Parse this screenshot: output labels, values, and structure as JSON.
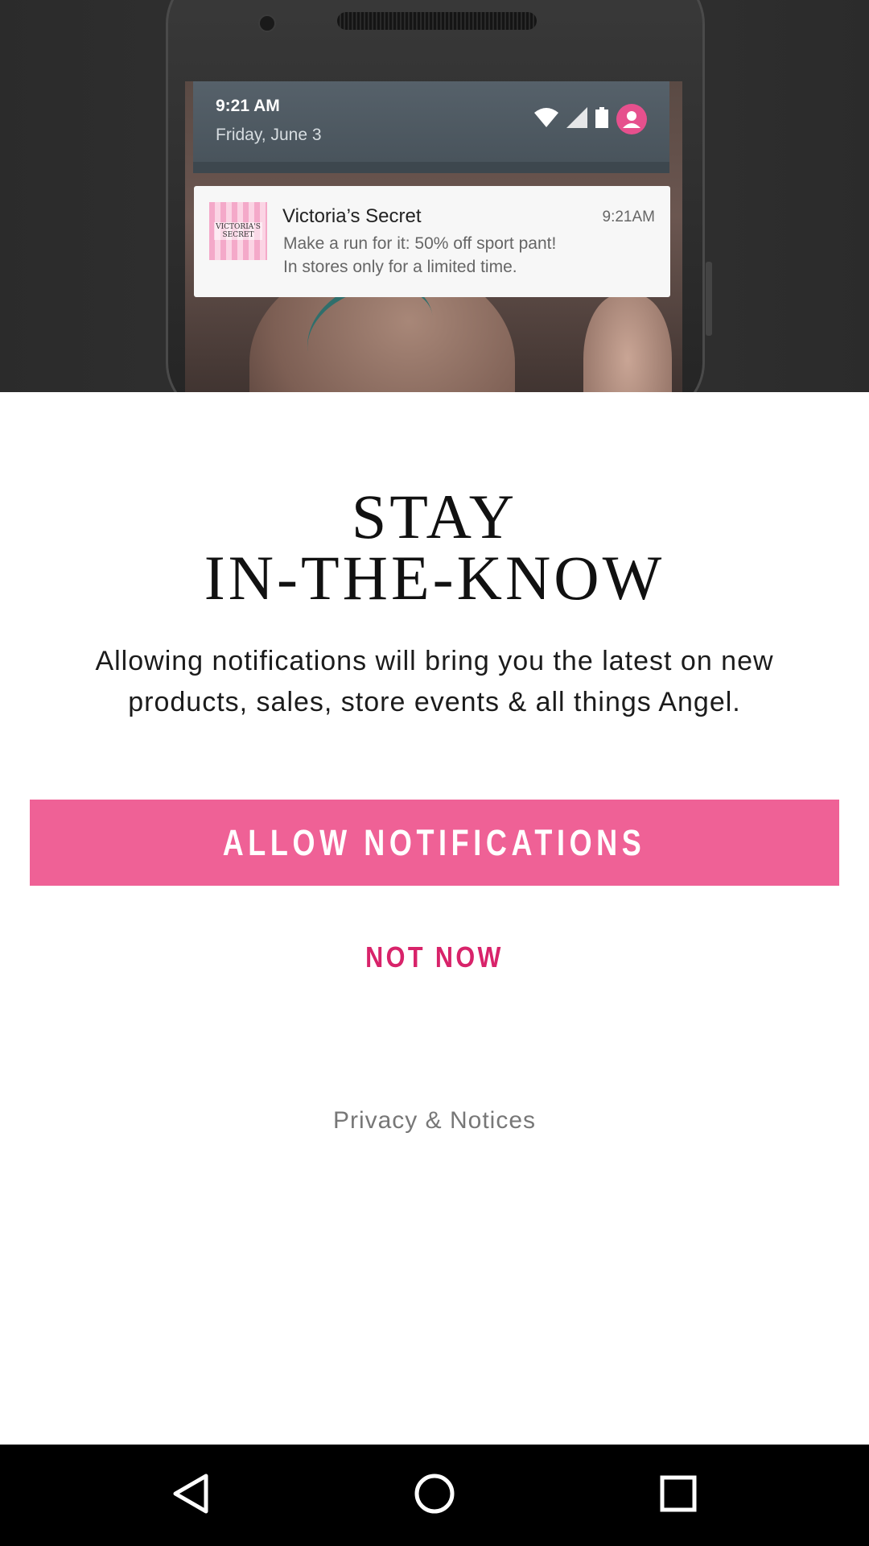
{
  "hero": {
    "status_time": "9:21 AM",
    "status_date": "Friday, June 3",
    "notification": {
      "logo_text": "VICTORIA'S\nSECRET",
      "title": "Victoria’s Secret",
      "time": "9:21AM",
      "line1": "Make a run for it: 50% off sport pant!",
      "line2": "In stores only for a limited time."
    },
    "icons": [
      "wifi-icon",
      "signal-icon",
      "battery-icon",
      "avatar-icon"
    ]
  },
  "headline": {
    "line1": "STAY",
    "line2": "IN-THE-KNOW"
  },
  "subtext": {
    "line1": "Allowing notifications will bring you the latest on new",
    "line2": "products, sales, store events & all things Angel."
  },
  "actions": {
    "allow_label": "ALLOW NOTIFICATIONS",
    "not_now_label": "NOT NOW",
    "privacy_label": "Privacy & Notices"
  },
  "navbar": {
    "icons": [
      "back-icon",
      "home-icon",
      "recents-icon"
    ]
  },
  "colors": {
    "accent_pink": "#ef6196",
    "not_now_pink": "#d8236a",
    "navbar": "#000000"
  }
}
